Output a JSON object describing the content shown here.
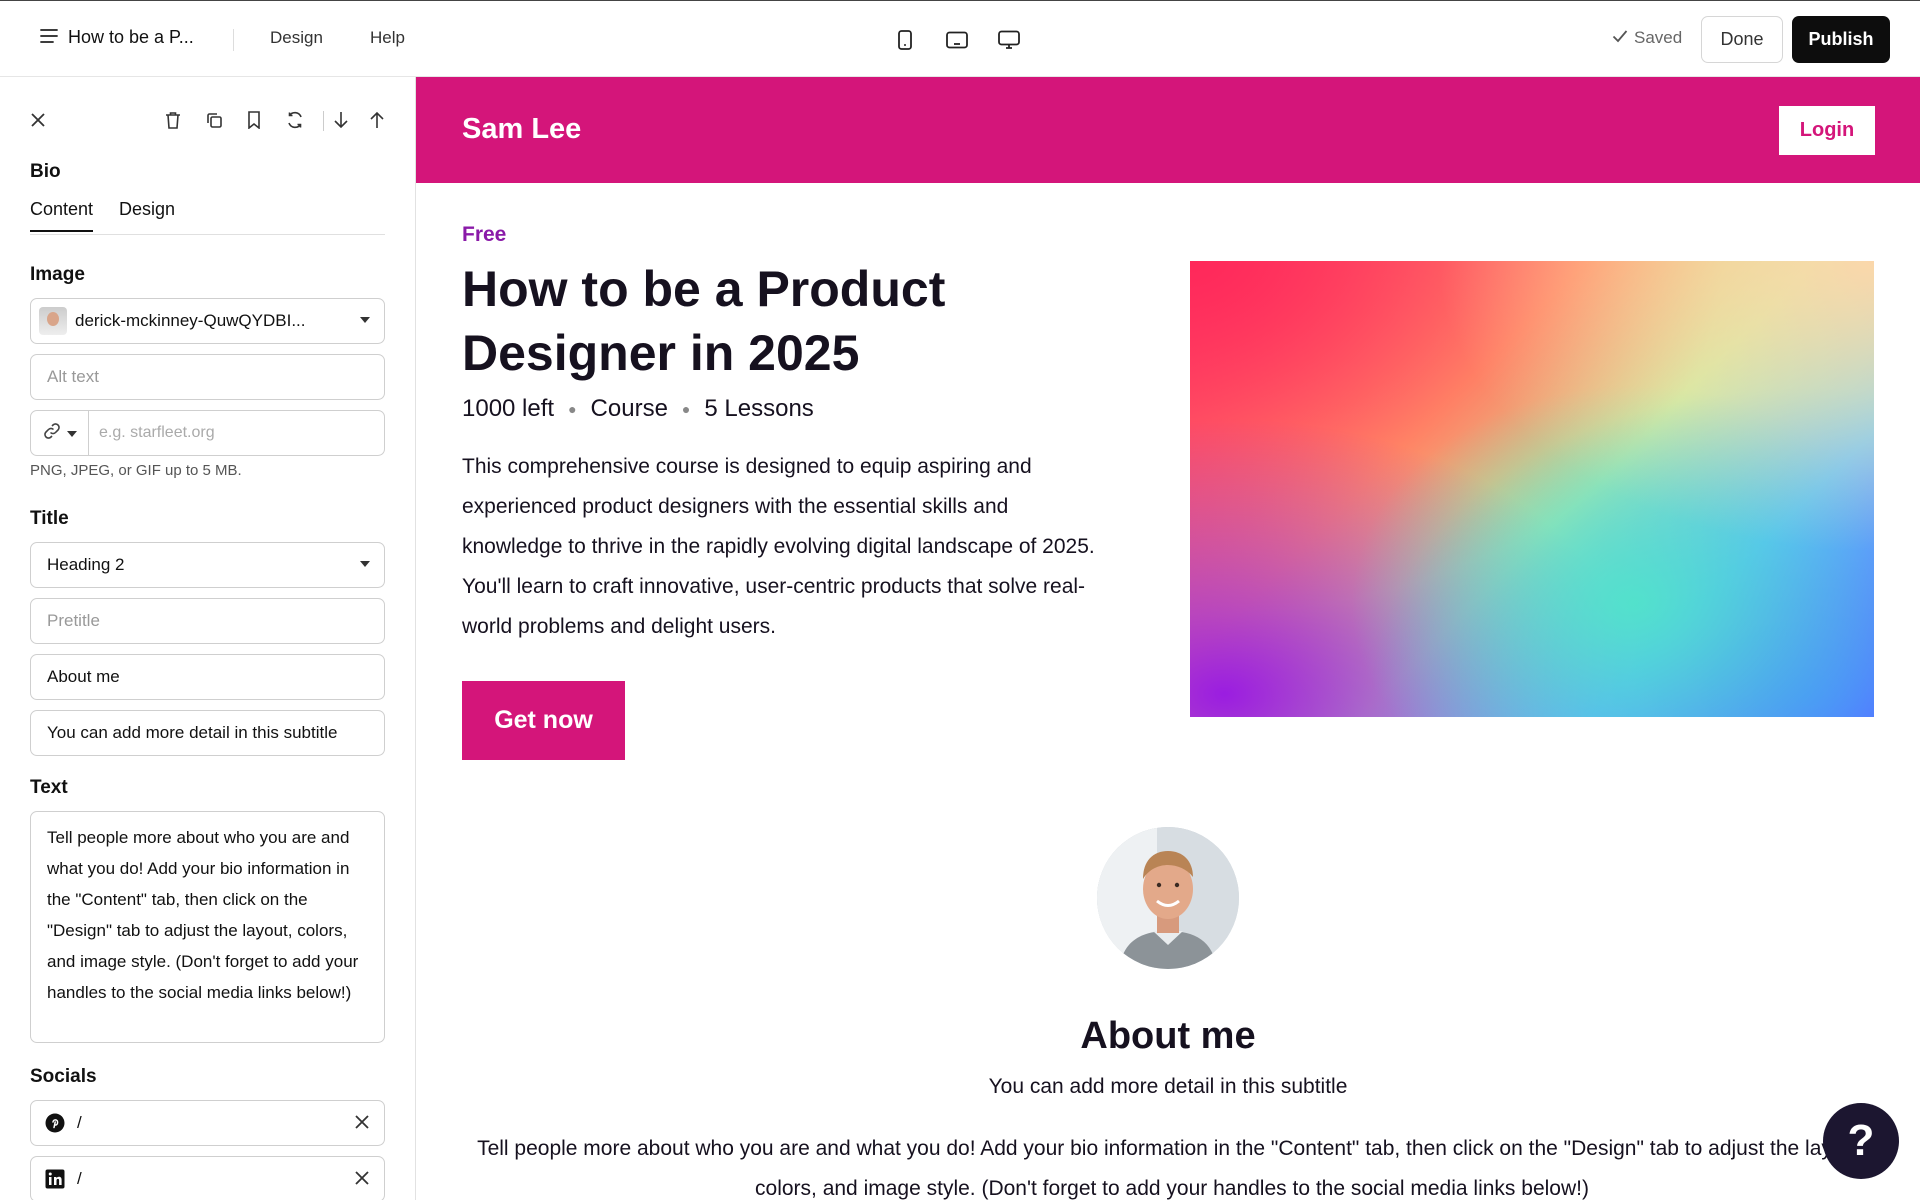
{
  "topbar": {
    "page_name": "How to be a P...",
    "menu_design": "Design",
    "menu_help": "Help",
    "saved": "Saved",
    "done": "Done",
    "publish": "Publish"
  },
  "panel": {
    "title": "Bio",
    "tabs": [
      "Content",
      "Design"
    ],
    "image_label": "Image",
    "image_file": "derick-mckinney-QuwQYDBI...",
    "alt_placeholder": "Alt text",
    "link_placeholder": "e.g. starfleet.org",
    "image_hint": "PNG, JPEG, or GIF up to 5 MB.",
    "title_label": "Title",
    "heading_level": "Heading 2",
    "pretitle_placeholder": "Pretitle",
    "title_value": "About me",
    "subtitle_value": "You can add more detail in this subtitle",
    "text_label": "Text",
    "text_value": "Tell people more about who you are and what you do! Add your bio information in the \"Content\" tab, then click on the \"Design\" tab to adjust the layout, colors, and image style. (Don't forget to add your handles to the social media links below!)",
    "socials_label": "Socials",
    "socials": [
      {
        "network": "pinterest-icon",
        "value": "/"
      },
      {
        "network": "linkedin-icon",
        "value": "/"
      }
    ]
  },
  "preview": {
    "site_name": "Sam Lee",
    "login": "Login",
    "price": "Free",
    "course_title": "How to be a Product Designer in 2025",
    "meta": [
      "1000 left",
      "Course",
      "5 Lessons"
    ],
    "description": "This comprehensive course is designed to equip aspiring and experienced product designers with the essential skills and knowledge to thrive in the rapidly evolving digital landscape of 2025. You'll learn to craft innovative, user-centric products that solve real-world problems and delight users.",
    "cta": "Get now",
    "about_title": "About me",
    "about_subtitle": "You can add more detail in this subtitle",
    "about_text": "Tell people more about who you are and what you do! Add your bio information in the \"Content\" tab, then click on the \"Design\" tab to adjust the layout, colors, and image style. (Don't forget to add your handles to the social media links below!)",
    "help": "?"
  },
  "colors": {
    "brand": "#d4157a",
    "price": "#8a1aa8",
    "text": "#16111f"
  }
}
